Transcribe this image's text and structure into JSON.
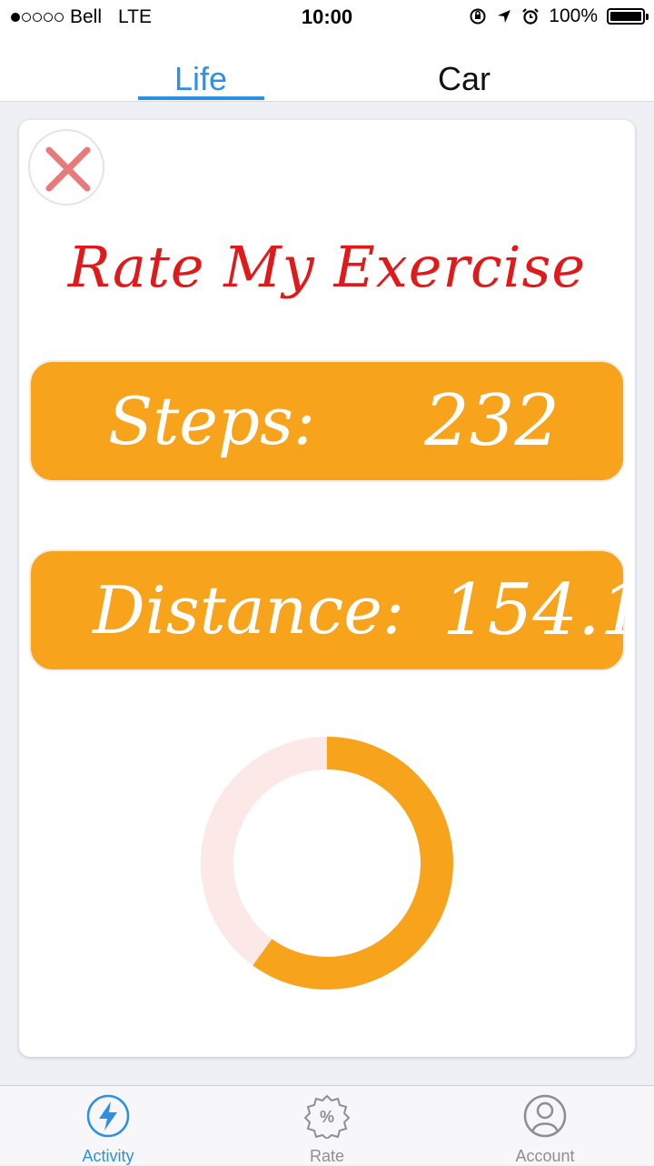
{
  "status_bar": {
    "carrier": "Bell",
    "network": "LTE",
    "time": "10:00",
    "battery": "100%"
  },
  "top_tabs": [
    {
      "label": "Life",
      "active": true
    },
    {
      "label": "Car",
      "active": false
    }
  ],
  "card": {
    "title": "Rate My Exercise",
    "steps_label": "Steps:",
    "steps_value": "232",
    "distance_label": "Distance:",
    "distance_value": "154.1",
    "progress_fraction": 0.6
  },
  "tab_bar": [
    {
      "label": "Activity",
      "icon": "bolt-icon",
      "active": true
    },
    {
      "label": "Rate",
      "icon": "percent-badge-icon",
      "active": false
    },
    {
      "label": "Account",
      "icon": "user-circle-icon",
      "active": false
    }
  ],
  "colors": {
    "accent_blue": "#2f8fe0",
    "pill_orange": "#f7a31c",
    "title_red": "#e01a1a",
    "ring_track": "#fde8e8",
    "close_red": "#e77b7b"
  }
}
